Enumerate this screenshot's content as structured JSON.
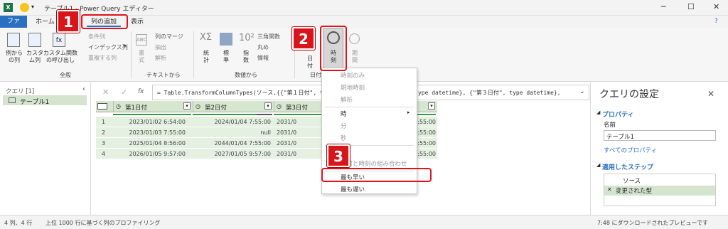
{
  "window": {
    "title": "テーブル1 - Power Query エディター"
  },
  "tabs": [
    "ファイル",
    "ホーム",
    "列の追加",
    "表示"
  ],
  "ribbon": {
    "general": {
      "btn1": "例から\nの列",
      "btn2": "カスタ\nム列",
      "btn3": "カスタム関数\nの呼び出し",
      "cond": "条件列",
      "index": "インデックス列",
      "dup": "重複する列",
      "label": "全般"
    },
    "text": {
      "format": "書\n式",
      "merge": "列のマージ",
      "extract": "抽出",
      "parse": "解析",
      "label": "テキストから"
    },
    "number": {
      "stats": "統\n計",
      "standard": "標\n準",
      "sci": "指\n数",
      "trig": "三角関数",
      "round": "丸め",
      "info": "情報",
      "label": "数値から"
    },
    "datetime": {
      "date": "日\n付",
      "time": "時\n刻",
      "duration": "期\n間",
      "label": "日付"
    }
  },
  "queries": {
    "header": "クエリ [1]",
    "items": [
      "テーブル1"
    ]
  },
  "formula": "= Table.TransformColumnTypes(ソース,{{\"第１日付\", type datetime}, {\"第２日付\", type datetime}, {\"第３日付\", type datetime},",
  "table": {
    "columns": [
      "第1日付",
      "第2日付",
      "第3日付"
    ],
    "rows": [
      [
        "1",
        "2023/01/02 6:54:00",
        "2024/01/04 7:55:00",
        "2031/0",
        "7:55:00"
      ],
      [
        "2",
        "2023/01/03 7:55:00",
        "null",
        "2031/0",
        "7:55:00"
      ],
      [
        "3",
        "2025/01/04 8:56:00",
        "2044/01/04 7:55:00",
        "2031/0",
        "7:55:00"
      ],
      [
        "4",
        "2026/01/05 9:57:00",
        "2027/01/05 9:57:00",
        "2031/0",
        "7:55:00"
      ]
    ]
  },
  "menu": {
    "items": [
      "時刻のみ",
      "現地時刻",
      "解析",
      "時",
      "分",
      "秒",
      "差",
      "日付と時刻の組み合わせ",
      "最も早い",
      "最も遅い"
    ]
  },
  "settings": {
    "title": "クエリの設定",
    "props": "プロパティ",
    "name_label": "名前",
    "name_value": "テーブル1",
    "all_props": "すべてのプロパティ",
    "steps_title": "適用したステップ",
    "steps": [
      "ソース",
      "変更された型"
    ]
  },
  "status": {
    "left": "4 列、4 行",
    "mid": "上位 1000 行に基づく列のプロファイリング",
    "right": "7:48 にダウンロードされたプレビューです"
  },
  "badges": [
    "1",
    "2",
    "3"
  ]
}
